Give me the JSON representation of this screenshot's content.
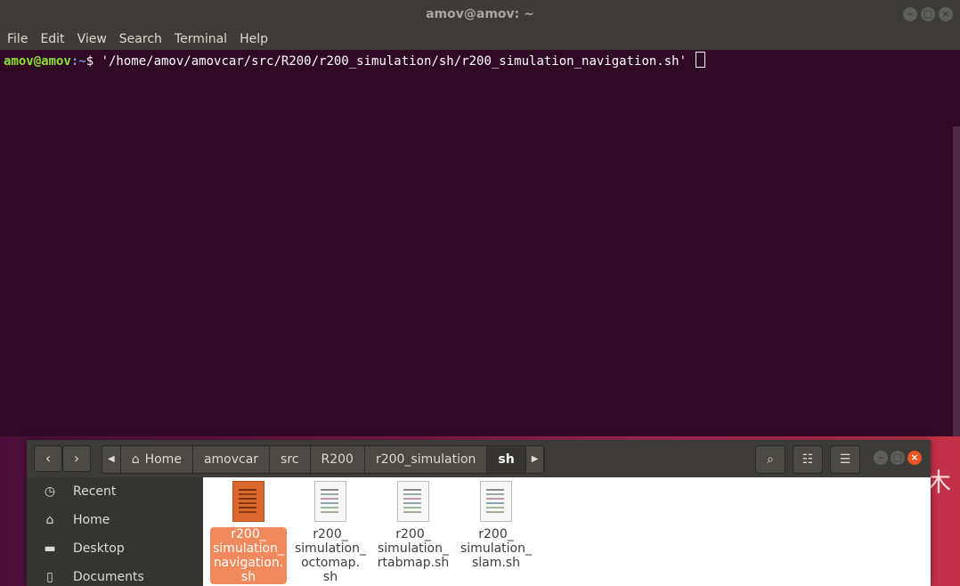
{
  "terminal": {
    "title": "amov@amov: ~",
    "menu": [
      "File",
      "Edit",
      "View",
      "Search",
      "Terminal",
      "Help"
    ],
    "prompt_user": "amov@amov",
    "prompt_path": ":~",
    "prompt_symbol": "$ ",
    "command": "'/home/amov/amovcar/src/R200/r200_simulation/sh/r200_simulation_navigation.sh' "
  },
  "files": {
    "breadcrumbs": [
      "Home",
      "amovcar",
      "src",
      "R200",
      "r200_simulation",
      "sh"
    ],
    "sidebar": [
      "Recent",
      "Home",
      "Desktop",
      "Documents"
    ],
    "items": [
      {
        "name": "r200_\nsimulation_\nnavigation.\nsh",
        "selected": true
      },
      {
        "name": "r200_\nsimulation_\noctomap.\nsh",
        "selected": false
      },
      {
        "name": "r200_\nsimulation_\nrtabmap.sh",
        "selected": false
      },
      {
        "name": "r200_\nsimulation_\nslam.sh",
        "selected": false
      }
    ]
  },
  "colors": {
    "terminal_bg": "#300a24",
    "accent": "#e95420",
    "selection": "#f08a5d"
  }
}
